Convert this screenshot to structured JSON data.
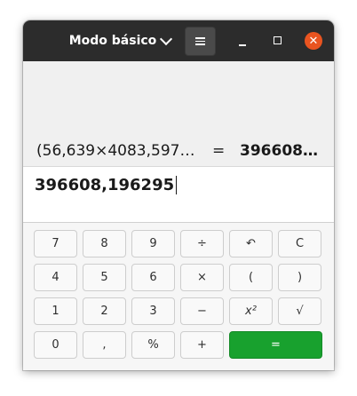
{
  "header": {
    "title": "Modo básico",
    "menu_icon": "hamburger-icon",
    "chevron_icon": "chevron-down-icon",
    "close_glyph": "✕",
    "close_color": "#e95420"
  },
  "history": {
    "expression": "(56,639×4083,597…",
    "equals": "=",
    "result": "396608…"
  },
  "input": {
    "value": "396608,196295"
  },
  "keys": {
    "row1": [
      "7",
      "8",
      "9",
      "÷",
      "↶",
      "C"
    ],
    "row2": [
      "4",
      "5",
      "6",
      "×",
      "(",
      ")"
    ],
    "row3": [
      "1",
      "2",
      "3",
      "−",
      "x²",
      "√"
    ],
    "row4": [
      "0",
      ",",
      "%",
      "+",
      "="
    ]
  },
  "colors": {
    "titlebar": "#2c2c2c",
    "equals_button": "#18a12e"
  }
}
